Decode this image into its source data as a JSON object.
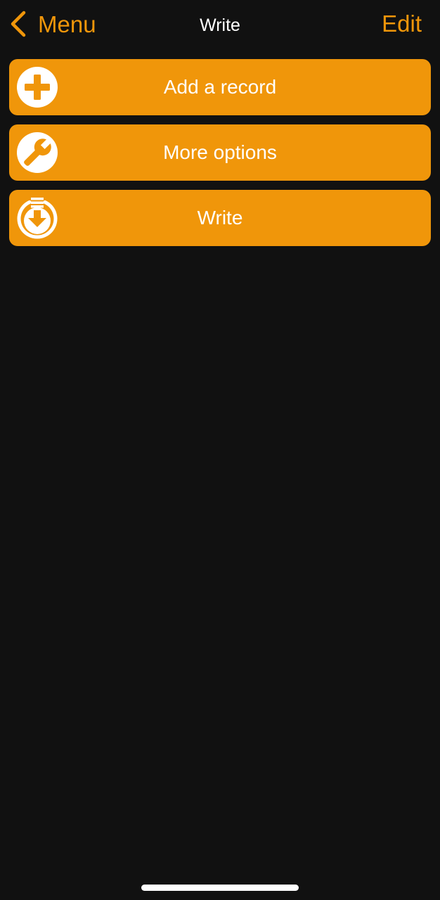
{
  "colors": {
    "background": "#111111",
    "accent": "#f0960a",
    "text": "#ffffff"
  },
  "nav": {
    "back_label": "Menu",
    "title": "Write",
    "edit_label": "Edit"
  },
  "actions": [
    {
      "label": "Add a record",
      "icon": "plus-circle-icon"
    },
    {
      "label": "More options",
      "icon": "wrench-icon"
    },
    {
      "label": "Write",
      "icon": "download-circle-icon"
    }
  ]
}
